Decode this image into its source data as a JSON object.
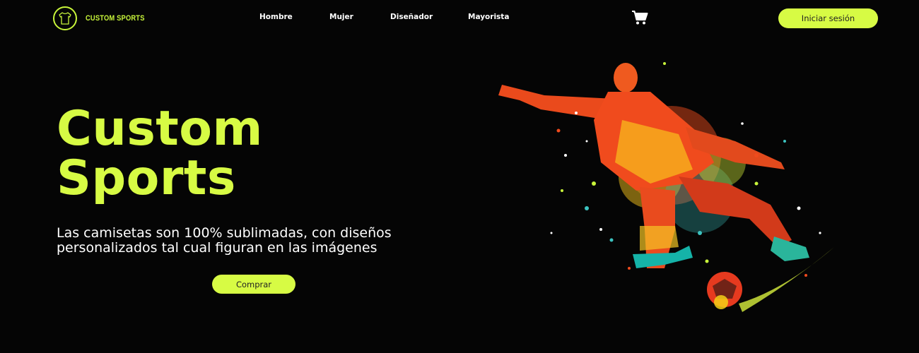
{
  "brand": {
    "name": "CUSTOM SPORTS"
  },
  "nav": {
    "items": [
      "Hombre",
      "Mujer",
      "Diseñador",
      "Mayorista"
    ],
    "login_label": "Iniciar sesión"
  },
  "hero": {
    "title_line1": "Custom",
    "title_line2": "Sports",
    "subtitle_line1": "Las camisetas son 100% sublimadas, con diseños",
    "subtitle_line2": "personalizados tal cual figuran en las imágenes",
    "cta_label": "Comprar"
  },
  "colors": {
    "accent": "#d7fb44",
    "background": "#050505"
  },
  "icons": {
    "cart": "shopping-cart-icon",
    "logo": "tshirt-logo-icon"
  }
}
